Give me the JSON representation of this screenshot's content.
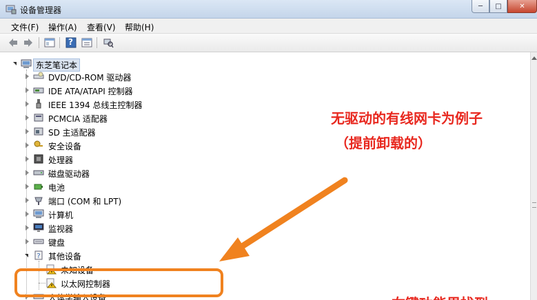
{
  "window": {
    "title": "设备管理器",
    "minimize_glyph": "─",
    "maximize_glyph": "□",
    "close_glyph": "✕"
  },
  "menu": [
    "文件(F)",
    "操作(A)",
    "查看(V)",
    "帮助(H)"
  ],
  "toolbar": {
    "icons": [
      "back-arrow-icon",
      "forward-arrow-icon",
      "show-hide-console-tree-icon",
      "help-icon",
      "properties-icon",
      "scan-hardware-icon"
    ],
    "help_glyph": "?"
  },
  "tree": {
    "root": {
      "label": "东芝笔记本",
      "icon": "computer-icon"
    },
    "categories": [
      {
        "label": "DVD/CD-ROM 驱动器",
        "icon": "dvd-drive-icon",
        "state": "collapsed"
      },
      {
        "label": "IDE ATA/ATAPI 控制器",
        "icon": "ide-controller-icon",
        "state": "collapsed"
      },
      {
        "label": "IEEE 1394 总线主控制器",
        "icon": "ieee1394-icon",
        "state": "collapsed"
      },
      {
        "label": "PCMCIA 适配器",
        "icon": "pcmcia-icon",
        "state": "collapsed"
      },
      {
        "label": "SD 主适配器",
        "icon": "sd-adapter-icon",
        "state": "collapsed"
      },
      {
        "label": "安全设备",
        "icon": "security-key-icon",
        "state": "collapsed"
      },
      {
        "label": "处理器",
        "icon": "processor-icon",
        "state": "collapsed"
      },
      {
        "label": "磁盘驱动器",
        "icon": "disk-drive-icon",
        "state": "collapsed"
      },
      {
        "label": "电池",
        "icon": "battery-icon",
        "state": "collapsed"
      },
      {
        "label": "端口 (COM 和 LPT)",
        "icon": "port-icon",
        "state": "collapsed"
      },
      {
        "label": "计算机",
        "icon": "computer-icon",
        "state": "collapsed"
      },
      {
        "label": "监视器",
        "icon": "monitor-icon",
        "state": "collapsed"
      },
      {
        "label": "键盘",
        "icon": "keyboard-icon",
        "state": "collapsed"
      },
      {
        "label": "其他设备",
        "icon": "unknown-device-icon",
        "state": "expanded"
      }
    ],
    "other_devices_children": [
      {
        "label": "未知设备",
        "icon": "warning-device-icon"
      },
      {
        "label": "以太网控制器",
        "icon": "warning-device-icon"
      }
    ],
    "partial_bottom_label": "人体学输入设备"
  },
  "annotation": {
    "title": "无驱动的有线网卡为例子",
    "subtitle": "（提前卸载的）",
    "bottom_partial": "右键功能里找到",
    "accent_color": "#e8281f",
    "box_color": "#f0821f"
  }
}
